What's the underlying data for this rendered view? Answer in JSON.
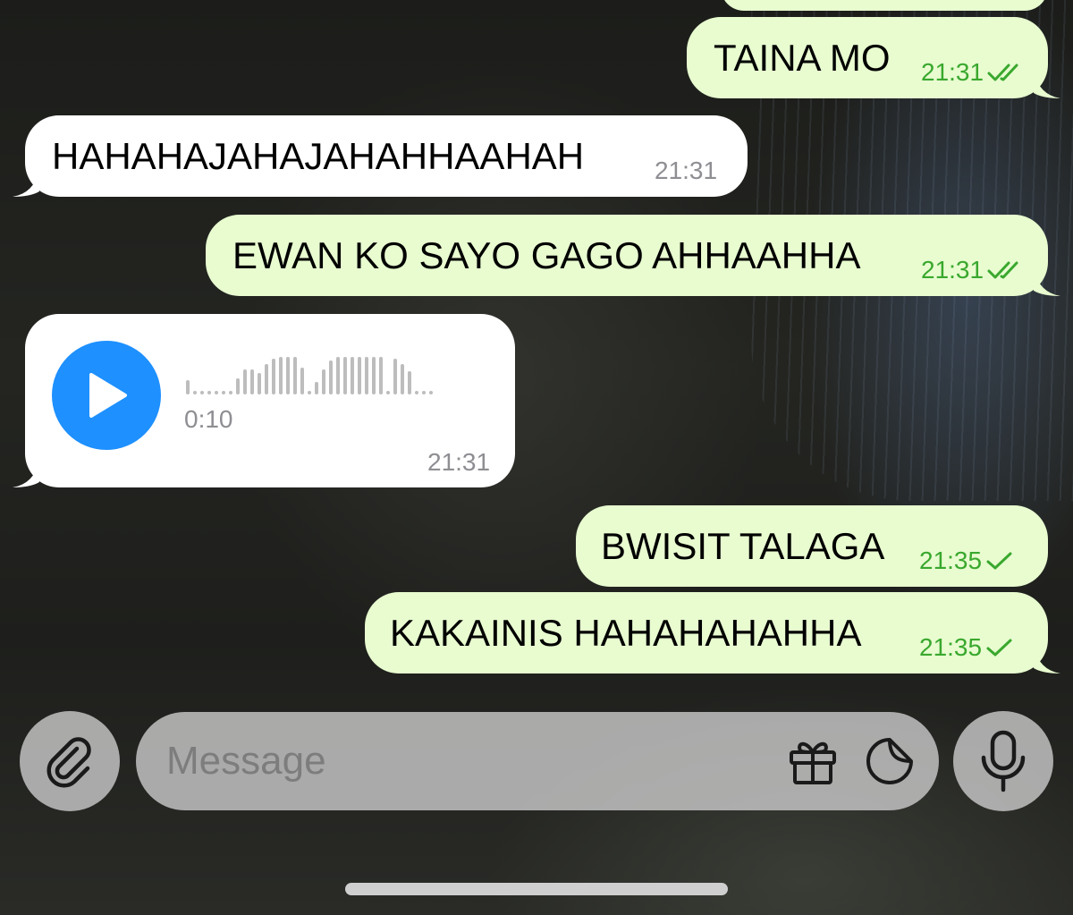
{
  "messages": [
    {
      "text": "",
      "time": "",
      "direction": "out"
    },
    {
      "text": "TAINA MO",
      "time": "21:31",
      "direction": "out",
      "status": "read"
    },
    {
      "text": "HAHAHAJAHAJAHAHHAAHAH",
      "time": "21:31",
      "direction": "in"
    },
    {
      "text": "EWAN KO SAYO GAGO AHHAAHHA",
      "time": "21:31",
      "direction": "out",
      "status": "read"
    },
    {
      "type": "voice",
      "duration": "0:10",
      "time": "21:31",
      "direction": "in"
    },
    {
      "text": "BWISIT TALAGA",
      "time": "21:35",
      "direction": "out",
      "status": "sent"
    },
    {
      "text": "KAKAINIS HAHAHAHAHHA",
      "time": "21:35",
      "direction": "out",
      "status": "sent"
    }
  ],
  "composer": {
    "placeholder": "Message",
    "attach_icon": "paperclip-icon",
    "gift_icon": "gift-icon",
    "sticker_icon": "sticker-icon",
    "mic_icon": "microphone-icon"
  },
  "colors": {
    "outgoing_bubble": "#e8fcd0",
    "incoming_bubble": "#ffffff",
    "outgoing_meta": "#3aa82e",
    "play_button": "#1e90ff"
  }
}
